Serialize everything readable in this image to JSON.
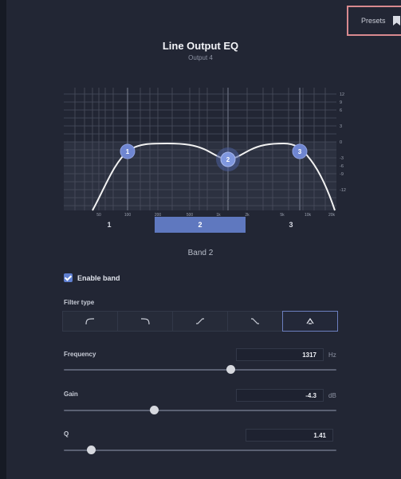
{
  "header": {
    "presets_label": "Presets",
    "title": "Line Output EQ",
    "subtitle": "Output 4"
  },
  "graph": {
    "y_ticks": [
      "12",
      "9",
      "6",
      "3",
      "0",
      "-3",
      "-6",
      "-9",
      "-12"
    ],
    "x_ticks": [
      "50",
      "100",
      "200",
      "500",
      "1k",
      "2k",
      "5k",
      "10k",
      "20k"
    ],
    "markers": [
      "1",
      "2",
      "3"
    ],
    "colors": {
      "curve": "#f2f2f2",
      "marker": "#6f86d1",
      "active_marker": "#8fa6e8"
    }
  },
  "bands": {
    "tabs": [
      "1",
      "2",
      "3"
    ],
    "active_index": 1,
    "heading": "Band 2"
  },
  "enable_band": {
    "label": "Enable band",
    "checked": true
  },
  "filter_type": {
    "label": "Filter type",
    "options": [
      "low-cut-icon",
      "high-cut-icon",
      "low-shelf-icon",
      "high-shelf-icon",
      "peak-icon"
    ],
    "selected": "peak-icon"
  },
  "frequency": {
    "label": "Frequency",
    "value": "1317",
    "unit": "Hz",
    "position": 0.61
  },
  "gain": {
    "label": "Gain",
    "value": "-4.3",
    "unit": "dB",
    "position": 0.33
  },
  "q": {
    "label": "Q",
    "value": "1.41",
    "position": 0.1
  },
  "accent": "#5f78bf"
}
